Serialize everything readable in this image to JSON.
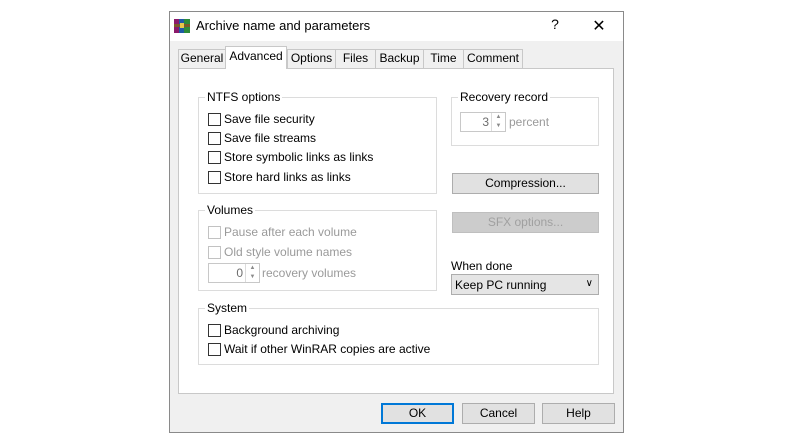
{
  "window": {
    "title": "Archive name and parameters",
    "help_label": "?",
    "close_label": "✕"
  },
  "tabs": [
    {
      "label": "General"
    },
    {
      "label": "Advanced",
      "active": true
    },
    {
      "label": "Options"
    },
    {
      "label": "Files"
    },
    {
      "label": "Backup"
    },
    {
      "label": "Time"
    },
    {
      "label": "Comment"
    }
  ],
  "ntfs": {
    "title": "NTFS options",
    "items": [
      {
        "label": "Save file security",
        "checked": false
      },
      {
        "label": "Save file streams",
        "checked": false
      },
      {
        "label": "Store symbolic links as links",
        "checked": false
      },
      {
        "label": "Store hard links as links",
        "checked": false
      }
    ]
  },
  "recovery": {
    "title": "Recovery record",
    "value": "3",
    "unit": "percent"
  },
  "buttons": {
    "compression": "Compression...",
    "sfx": "SFX options...",
    "ok": "OK",
    "cancel": "Cancel",
    "help": "Help"
  },
  "volumes": {
    "title": "Volumes",
    "items": [
      {
        "label": "Pause after each volume",
        "checked": false,
        "disabled": true
      },
      {
        "label": "Old style volume names",
        "checked": false,
        "disabled": true
      }
    ],
    "recovery_value": "0",
    "recovery_unit": "recovery volumes"
  },
  "when_done": {
    "label": "When done",
    "value": "Keep PC running"
  },
  "system": {
    "title": "System",
    "items": [
      {
        "label": "Background archiving",
        "checked": false
      },
      {
        "label": "Wait if other WinRAR copies are active",
        "checked": false
      }
    ]
  },
  "icons": {
    "app": "winrar-books-icon",
    "spin_up": "spin-up-arrow-icon",
    "spin_down": "spin-down-arrow-icon",
    "dropdown": "chevron-down-icon"
  },
  "colors": {
    "dialog_bg": "#f0f0f0",
    "panel_bg": "#ffffff",
    "default_button_border": "#0078d7"
  }
}
